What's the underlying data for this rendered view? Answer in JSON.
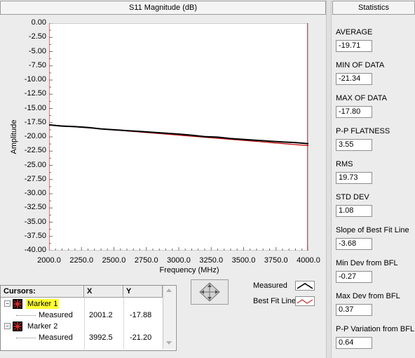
{
  "chart_panel": {
    "title": "S11 Magnitude (dB)"
  },
  "stats_panel": {
    "title": "Statistics",
    "items": [
      {
        "label": "AVERAGE",
        "value": "-19.71"
      },
      {
        "label": "MIN OF DATA",
        "value": "-21.34"
      },
      {
        "label": "MAX OF DATA",
        "value": "-17.80"
      },
      {
        "label": "P-P FLATNESS",
        "value": "3.55"
      },
      {
        "label": "RMS",
        "value": "19.73"
      },
      {
        "label": "STD DEV",
        "value": "1.08"
      },
      {
        "label": "Slope of Best Fit Line",
        "value": "-3.68"
      },
      {
        "label": "Min Dev from BFL",
        "value": "-0.27"
      },
      {
        "label": "Max Dev from BFL",
        "value": "0.37"
      },
      {
        "label": "P-P Variation from BFL",
        "value": "0.64"
      }
    ]
  },
  "chart_data": {
    "type": "line",
    "xlabel": "Frequency (MHz)",
    "ylabel": "Amplitude",
    "xlim": [
      2000,
      4000
    ],
    "ylim": [
      -40,
      0
    ],
    "x_ticks": [
      "2000.0",
      "2250.0",
      "2500.0",
      "2750.0",
      "3000.0",
      "3250.0",
      "3500.0",
      "3750.0",
      "4000.0"
    ],
    "y_ticks": [
      "0.00",
      "-2.50",
      "-5.00",
      "-7.50",
      "-10.00",
      "-12.50",
      "-15.00",
      "-17.50",
      "-20.00",
      "-22.50",
      "-25.00",
      "-27.50",
      "-30.00",
      "-32.50",
      "-35.00",
      "-37.50",
      "-40.00"
    ],
    "grid": false,
    "series": [
      {
        "name": "Measured",
        "color": "#000000",
        "x": [
          2000,
          2100,
          2200,
          2300,
          2400,
          2500,
          2600,
          2700,
          2800,
          2900,
          3000,
          3100,
          3200,
          3300,
          3400,
          3500,
          3600,
          3700,
          3800,
          3900,
          4000
        ],
        "y": [
          -17.88,
          -18.1,
          -18.2,
          -18.35,
          -18.6,
          -18.75,
          -18.9,
          -19.05,
          -19.2,
          -19.35,
          -19.5,
          -19.7,
          -19.95,
          -20.05,
          -20.3,
          -20.45,
          -20.6,
          -20.75,
          -20.9,
          -21.0,
          -21.2
        ]
      },
      {
        "name": "Best Fit Line",
        "color": "#c00000",
        "x": [
          2000,
          4000
        ],
        "y": [
          -17.86,
          -21.54
        ]
      }
    ]
  },
  "legend": {
    "items": [
      {
        "label": "Measured"
      },
      {
        "label": "Best Fit Line"
      }
    ]
  },
  "cursors": {
    "headers": [
      "Cursors:",
      "X",
      "Y"
    ],
    "rows": [
      {
        "name": "Marker 1",
        "x": "",
        "y": "",
        "highlight": true
      },
      {
        "name": "Measured",
        "x": "2001.2",
        "y": "-17.88"
      },
      {
        "name": "Marker 2",
        "x": "",
        "y": ""
      },
      {
        "name": "Measured",
        "x": "3992.5",
        "y": "-21.20"
      }
    ]
  },
  "icons": {
    "cursor_move": "diamond-move-icon",
    "marker": "crosshair-marker-icon"
  },
  "colors": {
    "plot_bg": "#ffffff",
    "measured": "#000000",
    "bestfit": "#c00000",
    "highlight": "#ffff33"
  }
}
